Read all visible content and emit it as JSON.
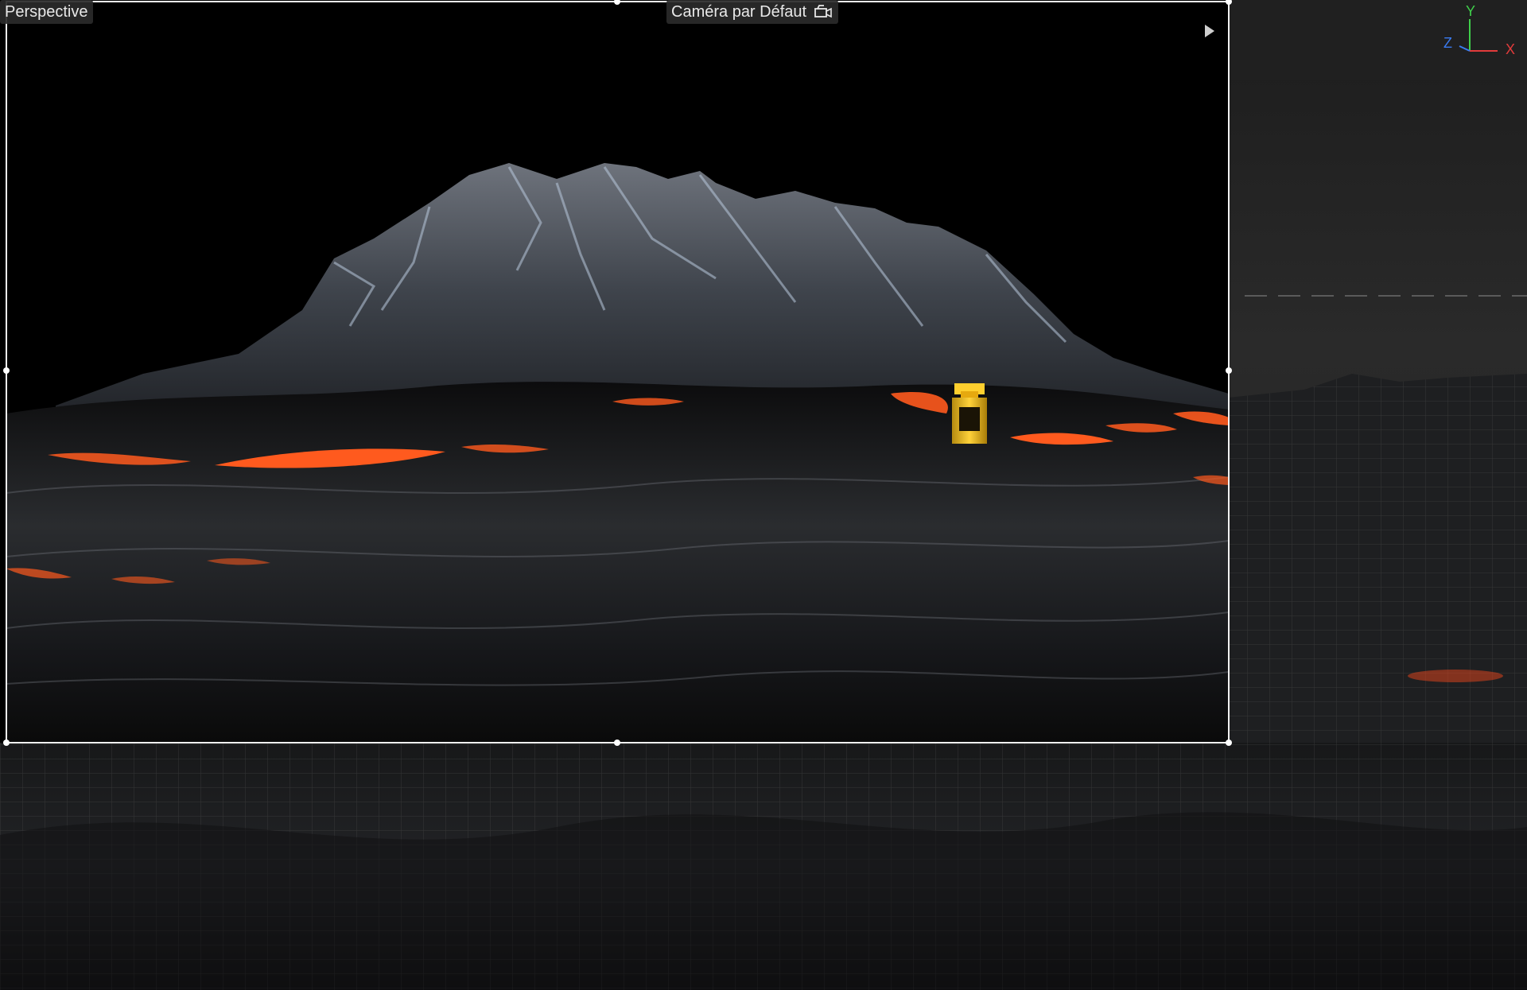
{
  "viewport": {
    "view_name": "Perspective",
    "camera_name": "Caméra par Défaut",
    "camera_icon": "camera-switch-icon",
    "play_icon": "play-triangle-icon"
  },
  "axis_gizmo": {
    "y_label": "Y",
    "z_label": "Z",
    "x_label": "X",
    "colors": {
      "x": "#e23b3b",
      "y": "#3fcf4a",
      "z": "#3a7bf0"
    }
  },
  "colors": {
    "background": "#000000",
    "frame": "#ffffff",
    "lava": "#ff5a1e",
    "ui_panel": "#2a2a2a"
  }
}
